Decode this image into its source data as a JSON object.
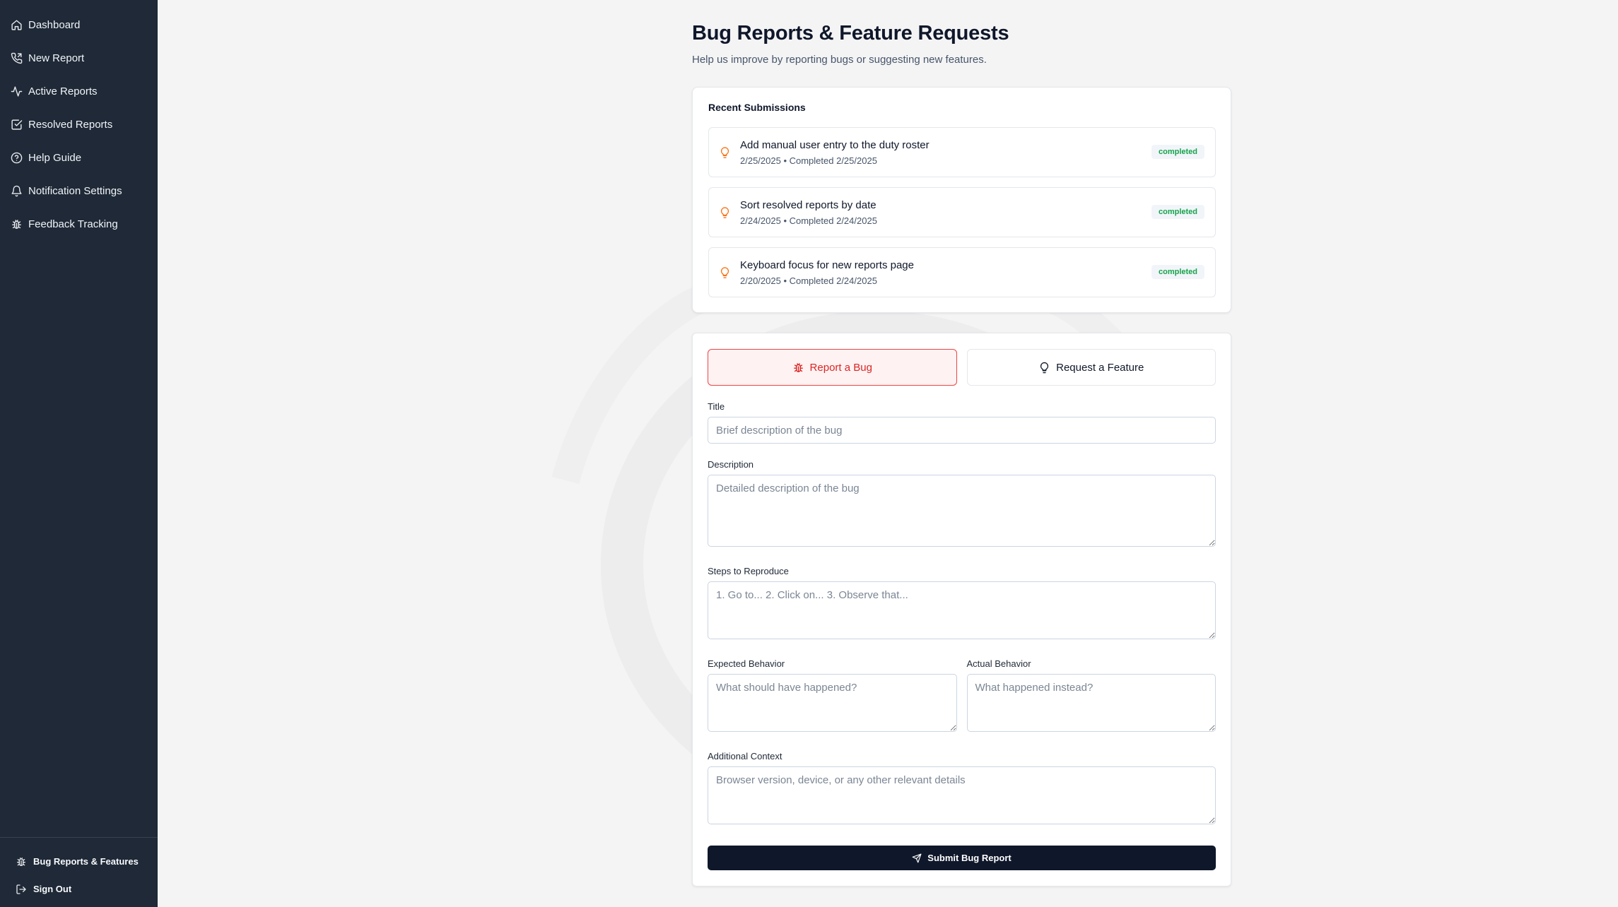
{
  "sidebar": {
    "items": [
      {
        "label": "Dashboard",
        "icon": "home-icon"
      },
      {
        "label": "New Report",
        "icon": "phone-icon"
      },
      {
        "label": "Active Reports",
        "icon": "activity-icon"
      },
      {
        "label": "Resolved Reports",
        "icon": "check-square-icon"
      },
      {
        "label": "Help Guide",
        "icon": "help-circle-icon"
      },
      {
        "label": "Notification Settings",
        "icon": "bell-icon"
      },
      {
        "label": "Feedback Tracking",
        "icon": "bug-icon"
      }
    ],
    "bottom": [
      {
        "label": "Bug Reports & Features",
        "icon": "bug-icon"
      },
      {
        "label": "Sign Out",
        "icon": "log-out-icon"
      }
    ]
  },
  "header": {
    "title": "Bug Reports & Feature Requests",
    "subtitle": "Help us improve by reporting bugs or suggesting new features."
  },
  "recent": {
    "title": "Recent Submissions",
    "items": [
      {
        "title": "Add manual user entry to the duty roster",
        "meta": "2/25/2025 • Completed 2/25/2025",
        "status": "completed"
      },
      {
        "title": "Sort resolved reports by date",
        "meta": "2/24/2025 • Completed 2/24/2025",
        "status": "completed"
      },
      {
        "title": "Keyboard focus for new reports page",
        "meta": "2/20/2025 • Completed 2/24/2025",
        "status": "completed"
      }
    ]
  },
  "form": {
    "toggle_bug": "Report a Bug",
    "toggle_feature": "Request a Feature",
    "title_label": "Title",
    "title_placeholder": "Brief description of the bug",
    "description_label": "Description",
    "description_placeholder": "Detailed description of the bug",
    "steps_label": "Steps to Reproduce",
    "steps_placeholder": "1. Go to... 2. Click on... 3. Observe that...",
    "expected_label": "Expected Behavior",
    "expected_placeholder": "What should have happened?",
    "actual_label": "Actual Behavior",
    "actual_placeholder": "What happened instead?",
    "context_label": "Additional Context",
    "context_placeholder": "Browser version, device, or any other relevant details",
    "submit_label": "Submit Bug Report"
  },
  "colors": {
    "sidebar_bg": "#1f2937",
    "accent_red": "#dc2626",
    "status_green": "#16a34a",
    "bulb_orange": "#f97316",
    "primary_dark": "#0f172a"
  }
}
